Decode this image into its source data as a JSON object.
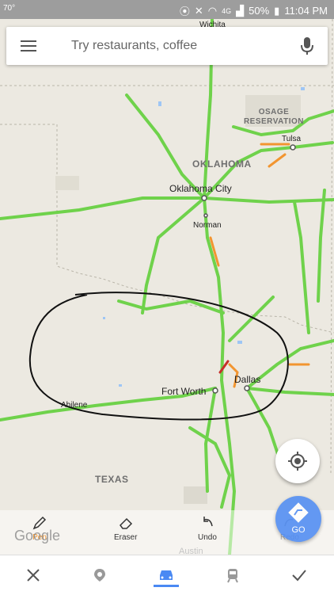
{
  "status_bar": {
    "temperature": "70°",
    "network": "4G",
    "battery": "50%",
    "time": "11:04 PM"
  },
  "search": {
    "placeholder": "Try restaurants, coffee"
  },
  "map": {
    "region_labels": [
      "OKLAHOMA",
      "TEXAS",
      "OSAGE RESERVATION"
    ],
    "cities": [
      "Wichita",
      "Tulsa",
      "Oklahoma City",
      "Norman",
      "Dallas",
      "Fort Worth",
      "Abilene",
      "Austin"
    ]
  },
  "pen_tools": {
    "pen_label": "Pen",
    "eraser_label": "Eraser",
    "undo_label": "Undo",
    "redo_label": "Redo"
  },
  "go_label": "GO",
  "watermark": "Google",
  "bottom_nav": {
    "items": [
      "close",
      "places",
      "drive",
      "transit",
      "more"
    ]
  },
  "colors": {
    "road": "#6fd24b",
    "traffic_orange": "#f29530",
    "traffic_red": "#c6302a",
    "go_blue": "#4a89f3"
  }
}
